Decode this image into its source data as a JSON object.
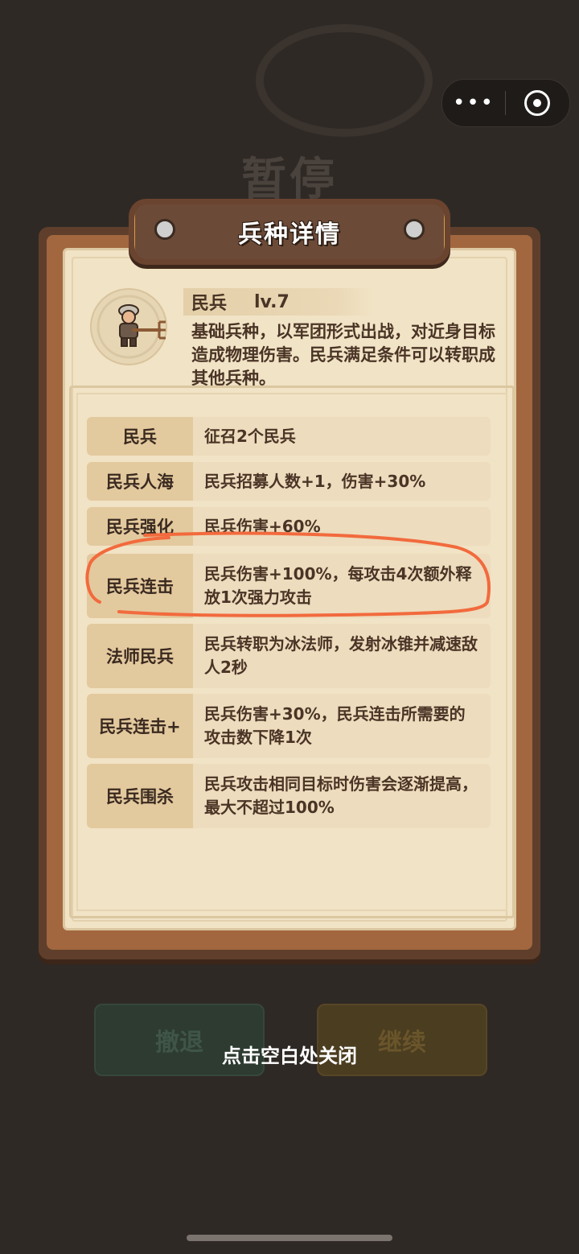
{
  "background": {
    "title": "暂停",
    "retreat_label": "撤退",
    "continue_label": "继续"
  },
  "panel": {
    "title": "兵种详情"
  },
  "unit": {
    "name": "民兵",
    "level": "lv.7",
    "description": "基础兵种，以军团形式出战，对近身目标造成物理伤害。民兵满足条件可以转职成其他兵种。"
  },
  "skills": [
    {
      "name": "民兵",
      "desc": "征召2个民兵"
    },
    {
      "name": "民兵人海",
      "desc": "民兵招募人数+1，伤害+30%"
    },
    {
      "name": "民兵强化",
      "desc": "民兵伤害+60%"
    },
    {
      "name": "民兵连击",
      "desc": "民兵伤害+100%，每攻击4次额外释放1次强力攻击"
    },
    {
      "name": "法师民兵",
      "desc": "民兵转职为冰法师，发射冰锥并减速敌人2秒"
    },
    {
      "name": "民兵连击+",
      "desc": "民兵伤害+30%，民兵连击所需要的攻击数下降1次"
    },
    {
      "name": "民兵围杀",
      "desc": "民兵攻击相同目标时伤害会逐渐提高，最大不超过100%"
    }
  ],
  "close_hint": "点击空白处关闭",
  "colors": {
    "annotation_stroke": "#f26a3d"
  }
}
